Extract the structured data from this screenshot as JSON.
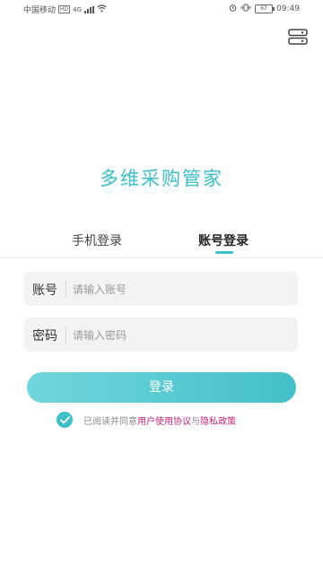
{
  "status_bar": {
    "carrier": "中国移动",
    "speed_badge": "HD",
    "network": "4G",
    "battery": "67",
    "time": "09:49",
    "icons": [
      "signal-icon",
      "wifi-icon",
      "alarm-icon",
      "vibrate-icon",
      "battery-icon"
    ]
  },
  "header": {
    "settings_icon": "server-settings-icon"
  },
  "app": {
    "title": "多维采购管家"
  },
  "tabs": [
    {
      "label": "手机登录",
      "active": false
    },
    {
      "label": "账号登录",
      "active": true
    }
  ],
  "form": {
    "account": {
      "label": "账号",
      "value": "",
      "placeholder": "请输入账号"
    },
    "password": {
      "label": "密码",
      "value": "",
      "placeholder": "请输入密码"
    }
  },
  "login_button": {
    "label": "登录"
  },
  "agreement": {
    "checked": true,
    "prefix": "已阅读并同意",
    "user_agreement": "用户使用协议",
    "conjunction": "与",
    "privacy_policy": "隐私政策"
  },
  "colors": {
    "accent": "#43c0c9",
    "link": "#c2247c"
  }
}
